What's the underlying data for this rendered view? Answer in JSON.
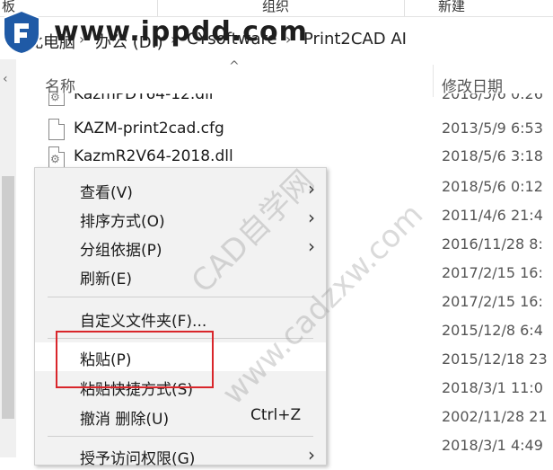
{
  "ribbon": {
    "left": "板",
    "middle": "组织",
    "right": "新建"
  },
  "watermark_site": "www.ippdd.com",
  "address": {
    "crumbs": [
      "此电脑",
      "办公 (D:)",
      "CYsoftware",
      "Print2CAD AI"
    ]
  },
  "columns": {
    "name": "名称",
    "modified": "修改日期"
  },
  "files": [
    {
      "name": "KazmPDT64-12.dll",
      "date": "2018/5/6 0:26",
      "icon": "gear-file-icon"
    },
    {
      "name": "KAZM-print2cad.cfg",
      "date": "2013/5/9 6:53",
      "icon": "blank-file-icon"
    },
    {
      "name": "KazmR2V64-2018.dll",
      "date": "2018/5/6 3:18",
      "icon": "gear-file-icon"
    }
  ],
  "dates_below": [
    "2018/5/6 0:12",
    "2011/4/6 21:4",
    "2016/11/28 8:",
    "2017/2/15 16:",
    "2017/2/15 16:",
    "2015/12/8 6:4",
    "2015/12/18 23",
    "2018/3/1 11:0",
    "2002/11/28 21",
    "2018/3/1 4:49"
  ],
  "context_menu": {
    "items": [
      {
        "label": "查看(V)",
        "submenu": true
      },
      {
        "label": "排序方式(O)",
        "submenu": true
      },
      {
        "label": "分组依据(P)",
        "submenu": true
      },
      {
        "label": "刷新(E)",
        "submenu": false
      },
      {
        "label": "自定义文件夹(F)...",
        "submenu": false
      },
      {
        "label": "粘贴(P)",
        "submenu": false
      },
      {
        "label": "粘贴快捷方式(S)",
        "submenu": false
      },
      {
        "label": "撤消 删除(U)",
        "shortcut": "Ctrl+Z",
        "submenu": false
      },
      {
        "label": "授予访问权限(G)",
        "submenu": true
      }
    ]
  },
  "watermark_text": [
    "CAD自学网",
    "www.cadzxw.com"
  ],
  "colors": {
    "highlight": "#d9262b",
    "menu_bg": "#f2f2f2"
  }
}
